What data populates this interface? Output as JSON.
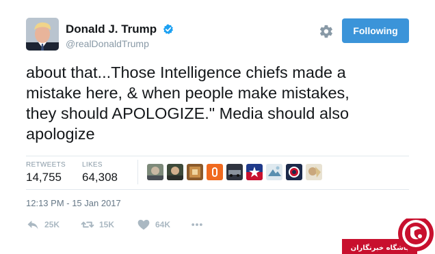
{
  "user": {
    "display_name": "Donald J. Trump",
    "handle": "@realDonaldTrump",
    "verified": true,
    "verified_icon": "verified-badge-icon"
  },
  "actions_bar": {
    "settings_icon": "gear-icon",
    "follow_label": "Following"
  },
  "tweet": {
    "text": "about that...Those Intelligence chiefs made a\nmistake here, & when people make mistakes,\nthey should APOLOGIZE.\" Media should also\napologize"
  },
  "stats": {
    "retweets_label": "RETWEETS",
    "retweets_value": "14,755",
    "likes_label": "LIKES",
    "likes_value": "64,308"
  },
  "likers_count_shown": 9,
  "timestamp": "12:13 PM - 15 Jan 2017",
  "footer_actions": [
    {
      "icon": "reply-icon",
      "count": "25K"
    },
    {
      "icon": "retweet-icon",
      "count": "15K"
    },
    {
      "icon": "heart-icon",
      "count": "64K"
    },
    {
      "icon": "more-icon",
      "count": ""
    }
  ],
  "watermark": {
    "text": "باشگاه خبرنگاران"
  },
  "colors": {
    "accent": "#3b94d9",
    "text": "#14171a",
    "muted": "#8899a6",
    "icon_gray": "#aab8c2",
    "watermark_red": "#c8102e"
  }
}
